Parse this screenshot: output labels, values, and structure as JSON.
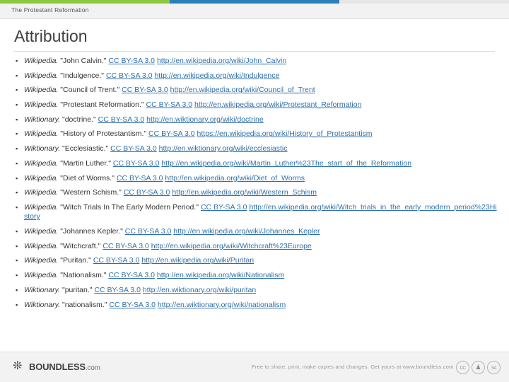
{
  "header": {
    "title": "The Protestant Reformation"
  },
  "page": {
    "title": "Attribution"
  },
  "bullet_glyph": "▪",
  "entries": [
    {
      "source": "Wikipedia.",
      "work": "\"John Calvin.\"",
      "license": "CC BY-SA 3.0",
      "url": "http://en.wikipedia.org/wiki/John_Calvin"
    },
    {
      "source": "Wikipedia.",
      "work": "\"Indulgence.\"",
      "license": "CC BY-SA 3.0",
      "url": "http://en.wikipedia.org/wiki/Indulgence"
    },
    {
      "source": "Wikipedia.",
      "work": "\"Council of Trent.\"",
      "license": "CC BY-SA 3.0",
      "url": "http://en.wikipedia.org/wiki/Council_of_Trent"
    },
    {
      "source": "Wikipedia.",
      "work": "\"Protestant Reformation.\"",
      "license": "CC BY-SA 3.0",
      "url": "http://en.wikipedia.org/wiki/Protestant_Reformation"
    },
    {
      "source": "Wiktionary.",
      "work": "\"doctrine.\"",
      "license": "CC BY-SA 3.0",
      "url": "http://en.wiktionary.org/wiki/doctrine"
    },
    {
      "source": "Wikipedia.",
      "work": "\"History of Protestantism.\"",
      "license": "CC BY-SA 3.0",
      "url": "https://en.wikipedia.org/wiki/History_of_Protestantism"
    },
    {
      "source": "Wiktionary.",
      "work": "\"Ecclesiastic.\"",
      "license": "CC BY-SA 3.0",
      "url": "http://en.wiktionary.org/wiki/ecclesiastic"
    },
    {
      "source": "Wikipedia.",
      "work": "\"Martin Luther.\"",
      "license": "CC BY-SA 3.0",
      "url": "http://en.wikipedia.org/wiki/Martin_Luther%23The_start_of_the_Reformation"
    },
    {
      "source": "Wikipedia.",
      "work": "\"Diet of Worms.\"",
      "license": "CC BY-SA 3.0",
      "url": "http://en.wikipedia.org/wiki/Diet_of_Worms"
    },
    {
      "source": "Wikipedia.",
      "work": "\"Western Schism.\"",
      "license": "CC BY-SA 3.0",
      "url": "http://en.wikipedia.org/wiki/Western_Schism"
    },
    {
      "source": "Wikipedia.",
      "work": "\"Witch Trials In The Early Modern Period.\"",
      "license": "CC BY-SA 3.0",
      "url": "http://en.wikipedia.org/wiki/Witch_trials_in_the_early_modern_period%23History"
    },
    {
      "source": "Wikipedia.",
      "work": "\"Johannes Kepler.\"",
      "license": "CC BY-SA 3.0",
      "url": "http://en.wikipedia.org/wiki/Johannes_Kepler"
    },
    {
      "source": "Wikipedia.",
      "work": "\"Witchcraft.\"",
      "license": "CC BY-SA 3.0",
      "url": "http://en.wikipedia.org/wiki/Witchcraft%23Europe"
    },
    {
      "source": "Wikipedia.",
      "work": "\"Puritan.\"",
      "license": "CC BY-SA 3.0",
      "url": "http://en.wikipedia.org/wiki/Puritan"
    },
    {
      "source": "Wikipedia.",
      "work": "\"Nationalism.\"",
      "license": "CC BY-SA 3.0",
      "url": "http://en.wikipedia.org/wiki/Nationalism"
    },
    {
      "source": "Wiktionary.",
      "work": "\"puritan.\"",
      "license": "CC BY-SA 3.0",
      "url": "http://en.wiktionary.org/wiki/puritan"
    },
    {
      "source": "Wiktionary.",
      "work": "\"nationalism.\"",
      "license": "CC BY-SA 3.0",
      "url": "http://en.wiktionary.org/wiki/nationalism"
    }
  ],
  "footer": {
    "brand_name": "BOUNDLESS",
    "brand_suffix": ".com",
    "note": "Free to share, print, make copies and changes. Get yours at www.boundless.com",
    "cc_icons": [
      "cc-logo-icon",
      "cc-by-icon",
      "cc-sa-icon"
    ]
  },
  "colors": {
    "accent_green": "#8dc63f",
    "accent_blue": "#2980b9",
    "link": "#2f6fa8",
    "text": "#333333"
  }
}
